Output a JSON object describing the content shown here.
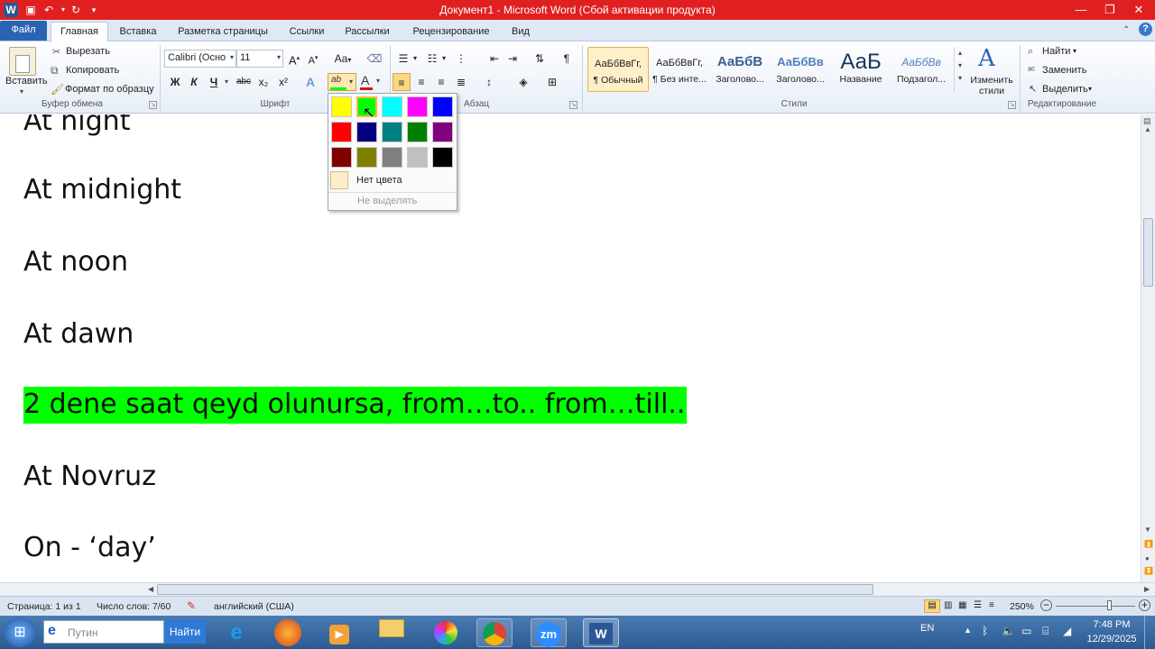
{
  "window": {
    "title": "Документ1  -  Microsoft Word (Сбой активации продукта)"
  },
  "tabs": [
    {
      "label": "Файл"
    },
    {
      "label": "Главная"
    },
    {
      "label": "Вставка"
    },
    {
      "label": "Разметка страницы"
    },
    {
      "label": "Ссылки"
    },
    {
      "label": "Рассылки"
    },
    {
      "label": "Рецензирование"
    },
    {
      "label": "Вид"
    }
  ],
  "clipboard": {
    "paste": "Вставить",
    "cut": "Вырезать",
    "copy": "Копировать",
    "format_painter": "Формат по образцу",
    "group": "Буфер обмена"
  },
  "font": {
    "family": "Calibri (Осно",
    "size": "11",
    "group": "Шрифт",
    "bold": "Ж",
    "italic": "К",
    "underline": "Ч",
    "strike": "abc",
    "subscript": "x₂",
    "superscript": "x²",
    "grow": "A",
    "shrink": "A",
    "case": "Aa",
    "highlight": "ab",
    "color": "A"
  },
  "paragraph": {
    "group": "Абзац"
  },
  "styles": {
    "group": "Стили",
    "items": [
      {
        "sample": "АаБбВвГг,",
        "name": "¶ Обычный"
      },
      {
        "sample": "АаБбВвГг,",
        "name": "¶ Без инте..."
      },
      {
        "sample": "АаБбВ",
        "name": "Заголово..."
      },
      {
        "sample": "АаБбВв",
        "name": "Заголово..."
      },
      {
        "sample": "АаБ",
        "name": "Название"
      },
      {
        "sample": "АаБбВв",
        "name": "Подзагол..."
      }
    ],
    "change": "Изменить стили"
  },
  "editing": {
    "group": "Редактирование",
    "find": "Найти",
    "replace": "Заменить",
    "select": "Выделить"
  },
  "highlight_menu": {
    "colors": [
      "#ffff00",
      "#00ff00",
      "#00ffff",
      "#ff00ff",
      "#0000ff",
      "#ff0000",
      "#000080",
      "#008080",
      "#008000",
      "#800080",
      "#800000",
      "#808000",
      "#808080",
      "#c0c0c0",
      "#000000"
    ],
    "selected": 1,
    "no_color": "Нет цвета",
    "stop": "Не выделять"
  },
  "document": {
    "highlight_color": "#00ff00",
    "lines": [
      "At night",
      "At midnight",
      "At noon",
      "At dawn",
      "2 dene saat qeyd olunursa, from…to..   from…till..",
      "At Novruz",
      "On -  ‘day’"
    ]
  },
  "status": {
    "page": "Страница: 1 из 1",
    "words": "Число слов: 7/60",
    "language": "английский (США)",
    "zoom": "250%"
  },
  "taskbar": {
    "search_placeholder": "Путин",
    "search_button": "Найти",
    "lang": "EN",
    "time": "7:48 PM",
    "date": "12/29/2025",
    "zoom_app": "zm",
    "word_app": "W"
  }
}
